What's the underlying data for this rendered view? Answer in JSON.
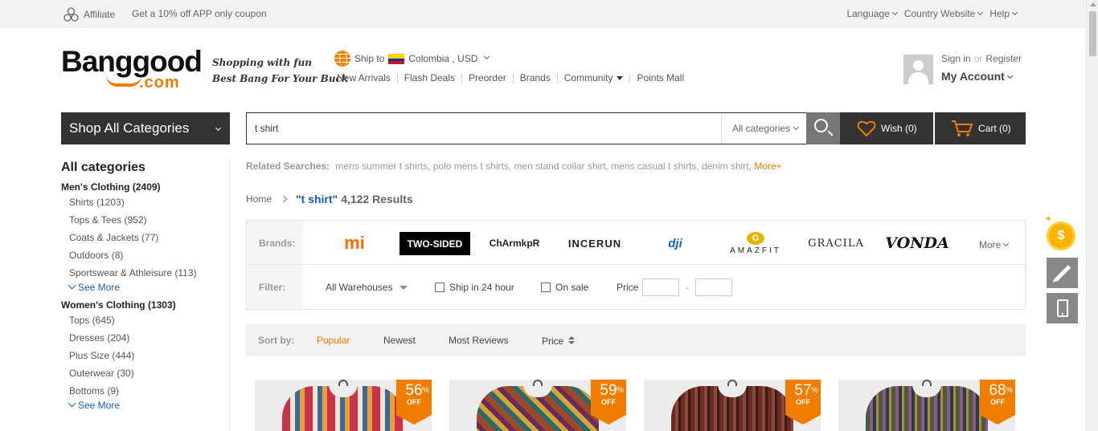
{
  "topbar": {
    "affiliate": "Affiliate",
    "coupon": "Get a 10% off APP only coupon",
    "language": "Language",
    "country_website": "Country Website",
    "help": "Help"
  },
  "header": {
    "logo_word": "Banggood",
    "logo_com": ".com",
    "slogan_line1": "Shopping with fun",
    "slogan_line2": "Best Bang For Your Buck",
    "ship_to_label": "Ship to",
    "ship_to_value": "Colombia , USD",
    "nav": [
      "New Arrivals",
      "Flash Deals",
      "Preorder",
      "Brands",
      "Community",
      "Points Mall"
    ],
    "sign_in": "Sign in",
    "or": "or",
    "register": "Register",
    "my_account": "My Account"
  },
  "search": {
    "shop_all": "Shop All Categories",
    "query": "t shirt",
    "category": "All categories",
    "wish": "Wish (0)",
    "cart": "Cart (0)"
  },
  "sidebar": {
    "title": "All categories",
    "groups": [
      {
        "name": "Men's Clothing (2409)",
        "items": [
          "Shirts (1203)",
          "Tops & Tees (952)",
          "Coats & Jackets (77)",
          "Outdoors (8)",
          "Sportswear & Athleisure (113)"
        ],
        "see_more": "See More"
      },
      {
        "name": "Women's Clothing (1303)",
        "items": [
          "Tops (645)",
          "Dresses (204)",
          "Plus Size (444)",
          "Outerwear (30)",
          "Bottoms (9)"
        ],
        "see_more": "See More"
      }
    ]
  },
  "related": {
    "label": "Related Searches:",
    "terms": [
      "mens summer t shirts,",
      "polo mens t shirts,",
      "men stand collar shirt,",
      "mens casual t shirts,",
      "denim shirt,"
    ],
    "more": "More+"
  },
  "breadcrumb": {
    "home": "Home",
    "query": "\"t shirt\"",
    "results": "4,122 Results"
  },
  "filters": {
    "brands_label": "Brands:",
    "brands": [
      "mi",
      "TWO-SIDED",
      "ChArmkpR",
      "INCERUN",
      "dji",
      "AMAZFIT",
      "GRACILA",
      "VONDA"
    ],
    "brands_more": "More",
    "filter_label": "Filter:",
    "warehouse": "All Warehouses",
    "ship24": "Ship in 24 hour",
    "on_sale": "On sale",
    "price": "Price",
    "price_dash": "-"
  },
  "sort": {
    "label": "Sort by:",
    "options": [
      "Popular",
      "Newest",
      "Most Reviews",
      "Price"
    ],
    "active": "Popular"
  },
  "products": [
    {
      "discount": "56",
      "pct": "%",
      "off": "OFF",
      "color": "#c8324a"
    },
    {
      "discount": "59",
      "pct": "%",
      "off": "OFF",
      "color": "#9c4a2a"
    },
    {
      "discount": "57",
      "pct": "%",
      "off": "OFF",
      "color": "#6b2a22"
    },
    {
      "discount": "68",
      "pct": "%",
      "off": "OFF",
      "color": "#4a5a3a"
    }
  ],
  "colors": {
    "accent": "#f07c00",
    "dark": "#333333",
    "link": "#1a5bb7"
  },
  "floating": {
    "coin": "$"
  }
}
